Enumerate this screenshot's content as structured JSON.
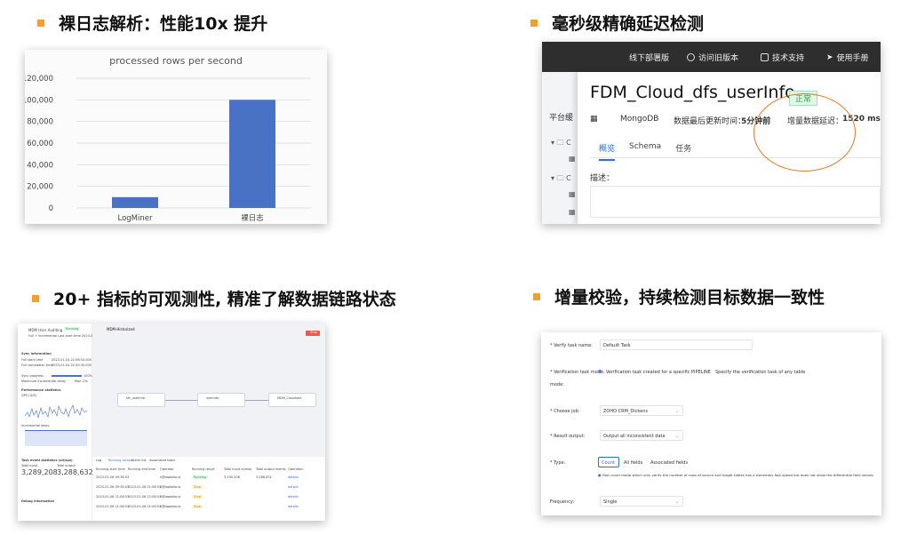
{
  "headings": {
    "logminer": "裸日志解析：性能10x 提升",
    "latency": "毫秒级精确延迟检测",
    "observability": "20+ 指标的可观测性, 精准了解数据链路状态",
    "verify": "增量校验，持续检测目标数据一致性"
  },
  "colors": {
    "bullet": "#f0a030",
    "bar": "#4a72c4",
    "ellipse": "#e07a2a"
  },
  "chart_data": {
    "type": "bar",
    "title": "processed rows per second",
    "categories": [
      "LogMiner",
      "裸日志"
    ],
    "values": [
      10000,
      100000
    ],
    "ylim": [
      0,
      120000
    ],
    "yticks": [
      "0",
      "20,000",
      "40,000",
      "60,000",
      "80,000",
      "100,000",
      "120,000"
    ],
    "grid": true,
    "legend": "none"
  },
  "monitor": {
    "nav": [
      "线下部署版",
      "访问旧版本",
      "技术支持",
      "使用手册"
    ],
    "nav_icons": [
      "none",
      "clock-icon",
      "help-icon",
      "send-icon"
    ],
    "sidebar_title": "平台缓",
    "tree": [
      "▾ 🗀 C",
      "▦",
      "▾ 🗀 C",
      "▦",
      "▦"
    ],
    "title": "FDM_Cloud_dfs_userInfo",
    "status": "正常",
    "db_type": "MongoDB",
    "updated_label": "数据最后更新时间：",
    "updated_value": "5分钟前",
    "latency_label": "增量数据延迟：",
    "latency_value": "1520 ms",
    "tabs": [
      "概览",
      "Schema",
      "任务"
    ],
    "desc_label": "描述："
  },
  "task": {
    "name": "MDM User Auditing",
    "status": "Running",
    "sub": "Full + Incremental   Last start time 2023-01-06 09:36:03",
    "rows": [
      [
        "Sync information",
        ""
      ],
      [
        "Full start time",
        "2023-01-04 22:08:54.000"
      ],
      [
        "Full completion time",
        "2023-01-04 22:09:30.000"
      ],
      [
        "Sync progress",
        "100%"
      ],
      [
        "Maximum incremental delay",
        "Mon 23s"
      ]
    ],
    "perf": "Performance statistics",
    "qps": "QPS  (Q/S)",
    "delay": "Incremental delay",
    "events": "Task event statistics (all/sps)",
    "total_input": "Total input",
    "total_input_value": "3,289,208",
    "total_output": "Total output",
    "total_output_value": "3,288,632",
    "debug": "Debug information",
    "canvas_title": "MDM-Historized",
    "nodes": [
      "sfc_userinfo",
      "userinfo",
      "MDM_Cloudtest"
    ],
    "stop": "Stop",
    "table_tabs": [
      "Log",
      "Running record",
      "Alarm list",
      "Associated tasks"
    ],
    "table_headers": [
      "Running start time",
      "Running end time",
      "Operator",
      "Running result",
      "Total input events",
      "Total output events",
      "Operation"
    ],
    "table_rows": [
      [
        "2023-01-06 09:36:03",
        "",
        "li@tapdata.io",
        "Running",
        "3,290,208",
        "3,288,632",
        "details"
      ],
      [
        "2023-01-06 09:36:03",
        "2023-01-06 21:08:53",
        "li@tapdata.io",
        "Stop",
        "",
        "",
        "details"
      ],
      [
        "2023-01-06 21:08:53",
        "2023-01-06 22:08:53",
        "li@tapdata.io",
        "Stop",
        "",
        "",
        "details"
      ],
      [
        "2023-01-06 21:08:53",
        "2023-01-06 21:08:53",
        "li@tapdata.io",
        "Stop",
        "",
        "",
        "details"
      ]
    ]
  },
  "verify": {
    "task_name_label": "* Verify task name:",
    "task_name_value": "Default Task",
    "mode_label": "* Verification task mode:",
    "mode_option1": "Verification task created for a specific PIPELINE",
    "mode_option2": "Specify the verification task of any table",
    "job_label": "* Choose job:",
    "job_value": "ZOHO CRM_Dickens",
    "result_label": "* Result output:",
    "result_value": "Output all inconsistent data",
    "type_label": "* Type:",
    "type_options": [
      "Count",
      "All fields",
      "Associated fields"
    ],
    "type_note": "Fast count mode which only verify the number of rows of source and target tables has a extremely fast speed but does not show the differential field values.",
    "frequency_label": "Frequency:",
    "frequency_value": "Single"
  }
}
